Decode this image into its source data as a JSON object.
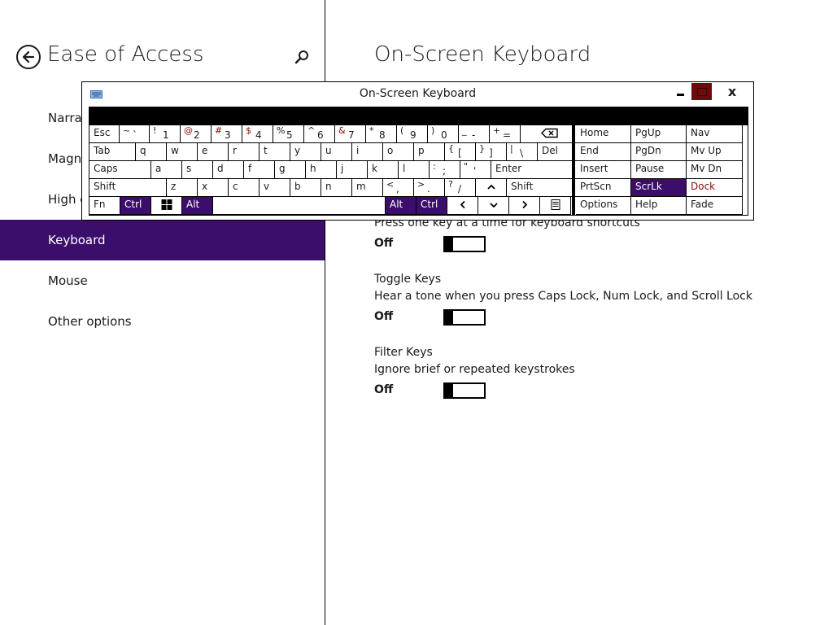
{
  "left_pane": {
    "title": "Ease of Access",
    "nav_items": [
      {
        "label": "Narrator",
        "name": "narrator"
      },
      {
        "label": "Magnifier",
        "name": "magnifier"
      },
      {
        "label": "High contrast",
        "name": "high-contrast"
      },
      {
        "label": "Keyboard",
        "name": "keyboard",
        "selected": true
      },
      {
        "label": "Mouse",
        "name": "mouse"
      },
      {
        "label": "Other options",
        "name": "other-options"
      }
    ]
  },
  "right_pane": {
    "title": "On-Screen Keyboard",
    "settings": [
      {
        "name": "sticky-keys",
        "title": "",
        "description": "Press one key at a time for keyboard shortcuts",
        "state": "Off"
      },
      {
        "name": "toggle-keys",
        "title": "Toggle Keys",
        "description": "Hear a tone when you press Caps Lock, Num Lock, and Scroll Lock",
        "state": "Off"
      },
      {
        "name": "filter-keys",
        "title": "Filter Keys",
        "description": "Ignore brief or repeated keystrokes",
        "state": "Off"
      }
    ]
  },
  "osk": {
    "title": "On-Screen Keyboard",
    "close_label": "x",
    "accent_color": "#3b0e6b",
    "maximize_color": "#6b0b0b",
    "rows": [
      [
        {
          "l": "Esc",
          "w": 37
        },
        {
          "s": "~",
          "m": "`",
          "w": 37
        },
        {
          "s": "!",
          "m": "1",
          "w": 38
        },
        {
          "s": "@",
          "m": "2",
          "w": 38,
          "rs": true
        },
        {
          "s": "#",
          "m": "3",
          "w": 38,
          "rs": true
        },
        {
          "s": "$",
          "m": "4",
          "w": 38,
          "rs": true
        },
        {
          "s": "%",
          "m": "5",
          "w": 38
        },
        {
          "s": "^",
          "m": "6",
          "w": 38
        },
        {
          "s": "&",
          "m": "7",
          "w": 38,
          "rs": true
        },
        {
          "s": "*",
          "m": "8",
          "w": 38
        },
        {
          "s": "(",
          "m": "9",
          "w": 38
        },
        {
          "s": ")",
          "m": "0",
          "w": 38
        },
        {
          "s": "_",
          "m": "-",
          "w": 38
        },
        {
          "s": "+",
          "m": "=",
          "w": 38
        },
        {
          "icon": "backspace-icon",
          "w": 73
        }
      ],
      [
        {
          "l": "Tab",
          "w": 57
        },
        {
          "l": "q",
          "w": 38
        },
        {
          "l": "w",
          "w": 38
        },
        {
          "l": "e",
          "w": 38
        },
        {
          "l": "r",
          "w": 38
        },
        {
          "l": "t",
          "w": 38
        },
        {
          "l": "y",
          "w": 38
        },
        {
          "l": "u",
          "w": 38
        },
        {
          "l": "i",
          "w": 38
        },
        {
          "l": "o",
          "w": 38
        },
        {
          "l": "p",
          "w": 38
        },
        {
          "s": "{",
          "m": "[",
          "w": 38
        },
        {
          "s": "}",
          "m": "]",
          "w": 38
        },
        {
          "s": "|",
          "m": "\\",
          "w": 38
        },
        {
          "l": "Del",
          "w": 53
        }
      ],
      [
        {
          "l": "Caps",
          "w": 76
        },
        {
          "l": "a",
          "w": 38
        },
        {
          "l": "s",
          "w": 38
        },
        {
          "l": "d",
          "w": 38
        },
        {
          "l": "f",
          "w": 38
        },
        {
          "l": "g",
          "w": 38
        },
        {
          "l": "h",
          "w": 38
        },
        {
          "l": "j",
          "w": 38
        },
        {
          "l": "k",
          "w": 38
        },
        {
          "l": "l",
          "w": 38
        },
        {
          "s": ":",
          "m": ";",
          "w": 38
        },
        {
          "s": "\"",
          "m": "'",
          "w": 38
        },
        {
          "l": "Enter",
          "w": 110
        }
      ],
      [
        {
          "l": "Shift",
          "w": 95
        },
        {
          "l": "z",
          "w": 38
        },
        {
          "l": "x",
          "w": 38
        },
        {
          "l": "c",
          "w": 38
        },
        {
          "l": "v",
          "w": 38
        },
        {
          "l": "b",
          "w": 38
        },
        {
          "l": "n",
          "w": 38
        },
        {
          "l": "m",
          "w": 38
        },
        {
          "s": "<",
          "m": ",",
          "w": 38
        },
        {
          "s": ">",
          "m": ".",
          "w": 38
        },
        {
          "s": "?",
          "m": "/",
          "w": 38
        },
        {
          "icon": "up-arrow-icon",
          "w": 38
        },
        {
          "l": "Shift",
          "w": 91
        }
      ],
      [
        {
          "l": "Fn",
          "w": 38
        },
        {
          "l": "Ctrl",
          "w": 38,
          "hl": true
        },
        {
          "icon": "windows-icon",
          "w": 38
        },
        {
          "l": "Alt",
          "w": 38,
          "hl": true
        },
        {
          "l": "",
          "w": 212
        },
        {
          "l": "Alt",
          "w": 38,
          "hl": true
        },
        {
          "l": "Ctrl",
          "w": 38,
          "hl": true
        },
        {
          "icon": "left-arrow-icon",
          "w": 38
        },
        {
          "icon": "down-arrow-icon",
          "w": 38
        },
        {
          "icon": "right-arrow-icon",
          "w": 38
        },
        {
          "icon": "menu-icon",
          "w": 38
        }
      ]
    ],
    "nav_keys": [
      [
        {
          "l": "Home"
        },
        {
          "l": "PgUp"
        },
        {
          "l": "Nav"
        }
      ],
      [
        {
          "l": "End"
        },
        {
          "l": "PgDn"
        },
        {
          "l": "Mv Up"
        }
      ],
      [
        {
          "l": "Insert"
        },
        {
          "l": "Pause"
        },
        {
          "l": "Mv Dn"
        }
      ],
      [
        {
          "l": "PrtScn"
        },
        {
          "l": "ScrLk",
          "hl": true
        },
        {
          "l": "Dock",
          "red": true
        }
      ],
      [
        {
          "l": "Options"
        },
        {
          "l": "Help"
        },
        {
          "l": "Fade"
        }
      ]
    ]
  }
}
